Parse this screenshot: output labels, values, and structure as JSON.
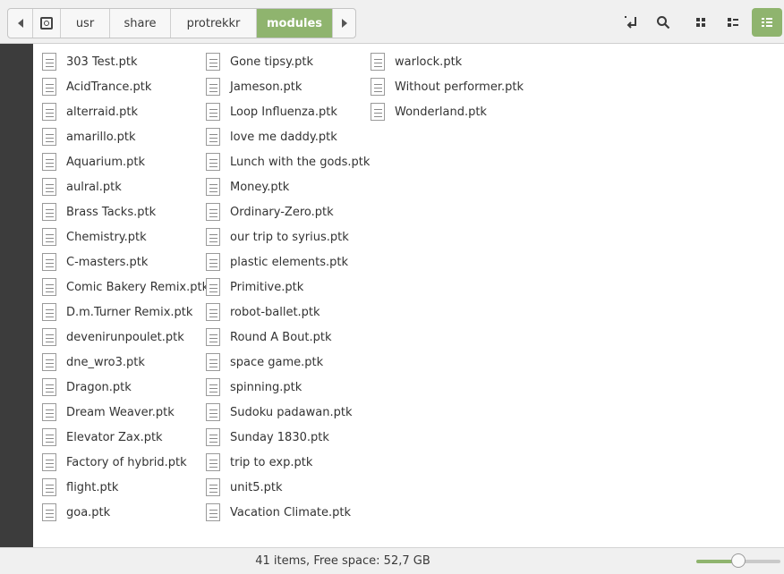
{
  "pathbar": {
    "segments": [
      "usr",
      "share",
      "protrekkr",
      "modules"
    ]
  },
  "toolbar_icons": [
    "toggle-location-icon",
    "search-icon",
    "icon-view-icon",
    "list-view-icon",
    "compact-view-icon"
  ],
  "accent_color": "#8fb46e",
  "files": {
    "col1": [
      "303 Test.ptk",
      "AcidTrance.ptk",
      "alterraid.ptk",
      "amarillo.ptk",
      "Aquarium.ptk",
      "aulral.ptk",
      "Brass Tacks.ptk",
      "Chemistry.ptk",
      "C-masters.ptk",
      "Comic Bakery Remix.ptk",
      "D.m.Turner Remix.ptk",
      "devenirunpoulet.ptk",
      "dne_wro3.ptk",
      "Dragon.ptk",
      "Dream Weaver.ptk",
      "Elevator Zax.ptk",
      "Factory of hybrid.ptk",
      "flight.ptk",
      "goa.ptk"
    ],
    "col2": [
      "Gone tipsy.ptk",
      "Jameson.ptk",
      "Loop Influenza.ptk",
      "love me daddy.ptk",
      "Lunch with the gods.ptk",
      "Money.ptk",
      "Ordinary-Zero.ptk",
      "our trip to syrius.ptk",
      "plastic elements.ptk",
      "Primitive.ptk",
      "robot-ballet.ptk",
      "Round A Bout.ptk",
      "space game.ptk",
      "spinning.ptk",
      "Sudoku padawan.ptk",
      "Sunday 1830.ptk",
      "trip to exp.ptk",
      "unit5.ptk",
      "Vacation Climate.ptk"
    ],
    "col3": [
      "warlock.ptk",
      "Without performer.ptk",
      "Wonderland.ptk"
    ]
  },
  "status": {
    "text": "41 items, Free space: 52,7 GB",
    "zoom_level": 0.5
  }
}
